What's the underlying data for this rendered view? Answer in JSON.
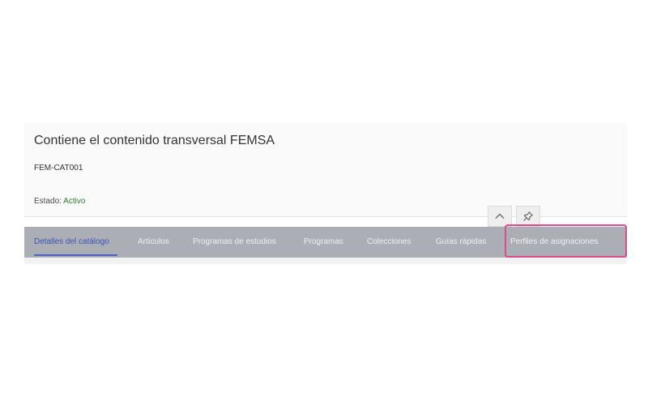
{
  "header": {
    "title": "Contiene el contenido transversal FEMSA",
    "catalog_id": "FEM-CAT001",
    "status_label": "Estado:",
    "status_value": "Activo"
  },
  "header_actions": {
    "collapse_icon": "chevron-up-icon",
    "pin_icon": "pin-icon"
  },
  "tabs": [
    {
      "label": "Detalles del catálogo",
      "selected": true
    },
    {
      "label": "Artículos",
      "selected": false
    },
    {
      "label": "Programas de estudios",
      "selected": false
    },
    {
      "label": "Programas",
      "selected": false
    },
    {
      "label": "Colecciones",
      "selected": false
    },
    {
      "label": "Guías rápidas",
      "selected": false
    },
    {
      "label": "Perfiles de asignaciones",
      "selected": false,
      "highlighted": true
    }
  ],
  "colors": {
    "accent": "#3a54b8",
    "status_active": "#2b7d2b",
    "highlight": "#e0488f",
    "tabbar_bg": "#acaeb6"
  }
}
